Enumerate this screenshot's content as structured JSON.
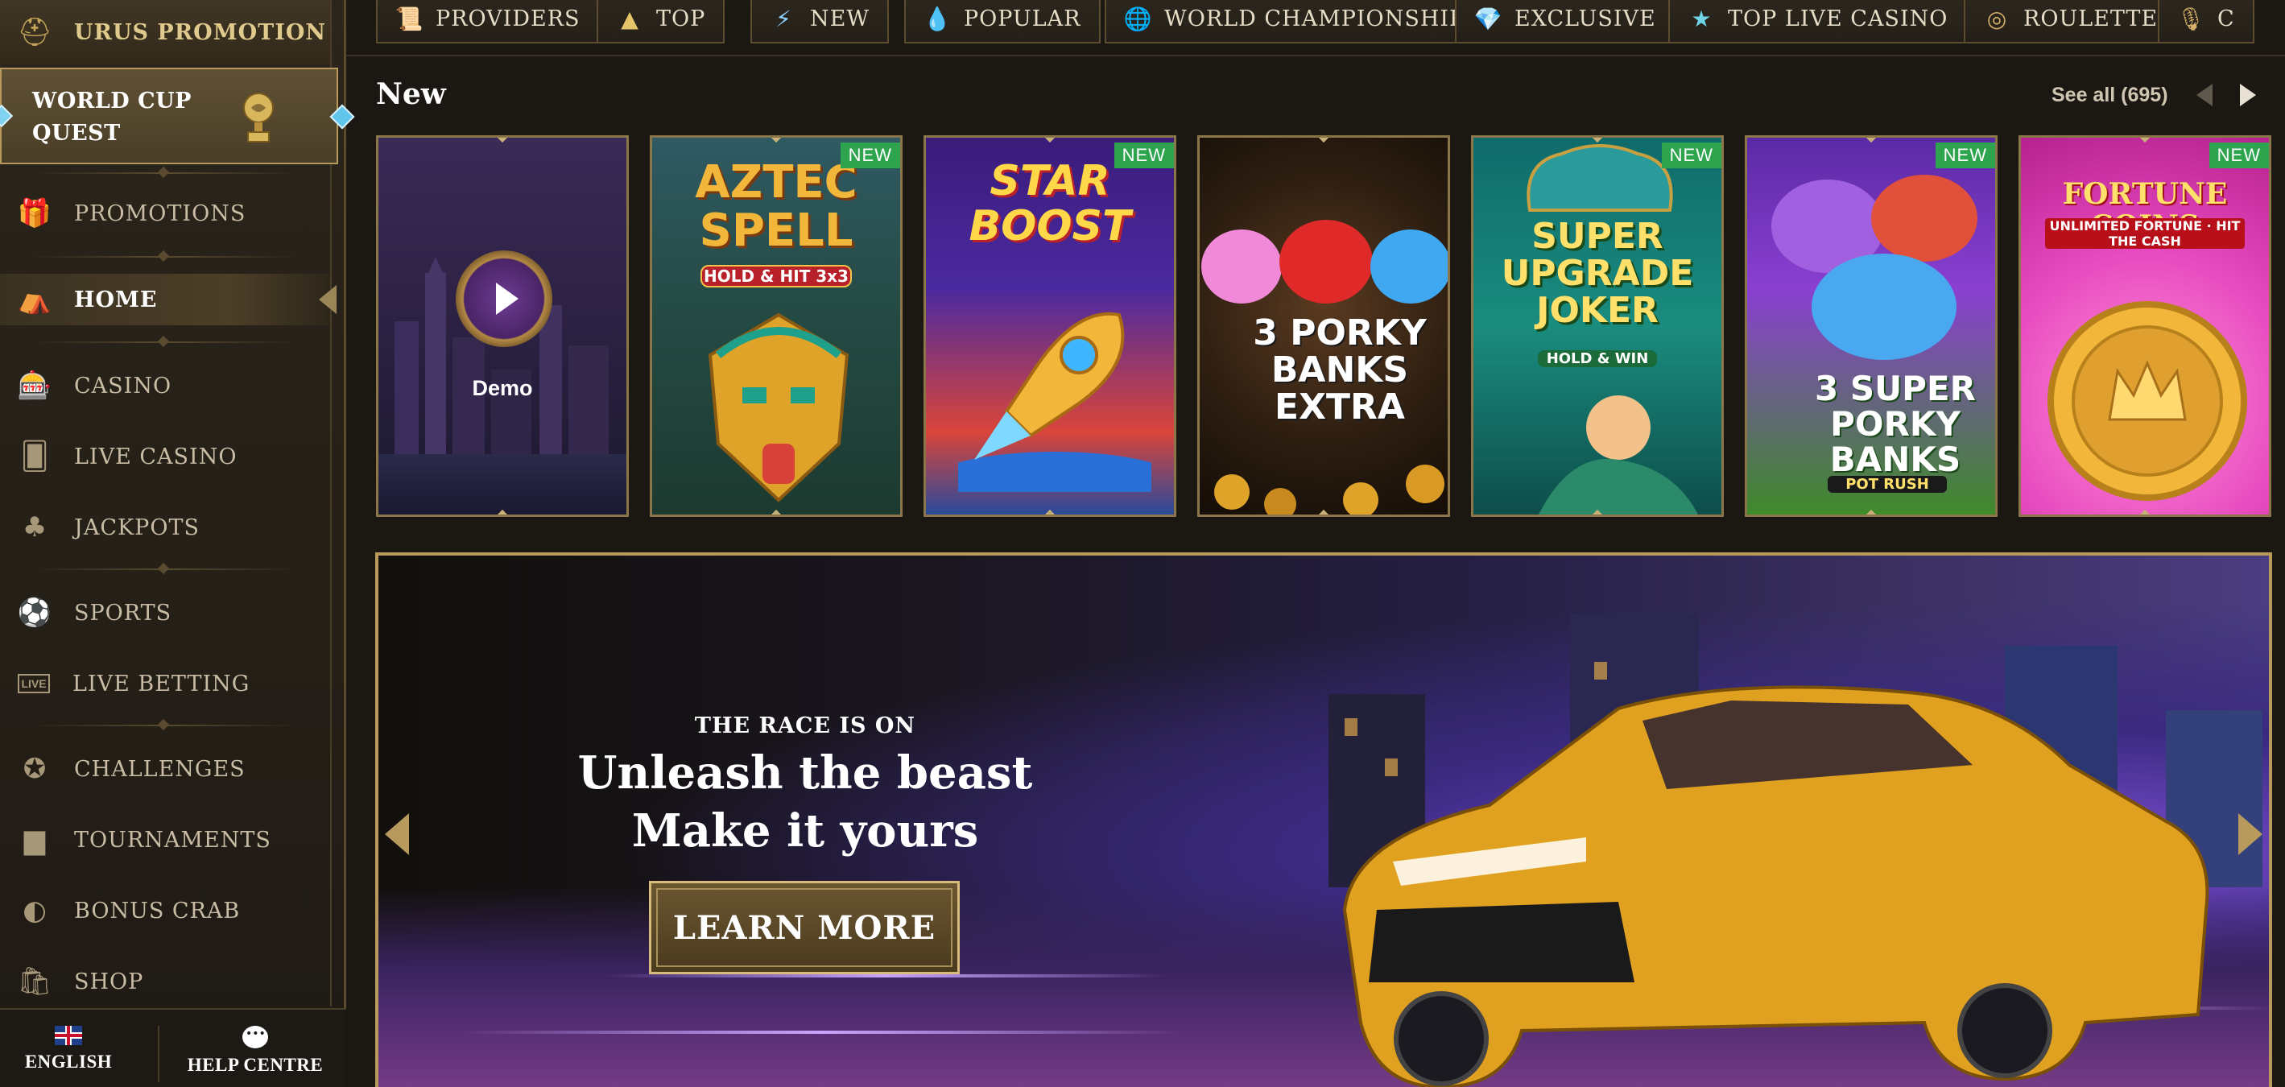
{
  "sidebar": {
    "promo": {
      "label": "URUS PROMOTION"
    },
    "quest": {
      "label_line1": "WORLD CUP",
      "label_line2": "QUEST"
    },
    "items": [
      {
        "label": "PROMOTIONS",
        "icon": "gift-icon"
      },
      {
        "label": "HOME",
        "icon": "home-icon",
        "active": true
      },
      {
        "label": "CASINO",
        "icon": "slot-machine-icon"
      },
      {
        "label": "LIVE CASINO",
        "icon": "playing-card-icon"
      },
      {
        "label": "JACKPOTS",
        "icon": "clover-icon"
      },
      {
        "label": "SPORTS",
        "icon": "ball-icon"
      },
      {
        "label": "LIVE BETTING",
        "icon": "live-icon",
        "icon_text": "LIVE"
      },
      {
        "label": "CHALLENGES",
        "icon": "badge-icon"
      },
      {
        "label": "TOURNAMENTS",
        "icon": "podium-icon"
      },
      {
        "label": "BONUS CRAB",
        "icon": "claw-icon"
      },
      {
        "label": "SHOP",
        "icon": "shopping-bag-icon"
      }
    ],
    "footer": {
      "language": "ENGLISH",
      "help": "HELP CENTRE"
    }
  },
  "categories": [
    {
      "label": "PROVIDERS",
      "icon": "scroll-icon",
      "glyph": "📜"
    },
    {
      "label": "TOP",
      "icon": "pyramid-icon",
      "glyph": "▲"
    },
    {
      "label": "NEW",
      "icon": "lightning-icon",
      "glyph": "⚡"
    },
    {
      "label": "POPULAR",
      "icon": "flame-icon",
      "glyph": "💧"
    },
    {
      "label": "WORLD CHAMPIONSHIP",
      "icon": "globe-icon",
      "glyph": "🌐"
    },
    {
      "label": "EXCLUSIVE",
      "icon": "gem-icon",
      "glyph": "💎"
    },
    {
      "label": "TOP LIVE CASINO",
      "icon": "star-icon",
      "glyph": "★"
    },
    {
      "label": "ROULETTE",
      "icon": "roulette-icon",
      "glyph": "◎"
    },
    {
      "label": "C",
      "icon": "microphone-icon",
      "glyph": "🎙"
    }
  ],
  "section": {
    "title": "New",
    "see_all": "See all (695)"
  },
  "games": [
    {
      "title": "",
      "demo_label": "Demo",
      "badge": ""
    },
    {
      "title": "AZTEC SPELL",
      "subtitle": "HOLD & HIT 3x3",
      "badge": "NEW"
    },
    {
      "title": "STAR BOOST",
      "subtitle": "",
      "badge": "NEW"
    },
    {
      "title": "3 PORKY BANKS EXTRA",
      "subtitle": "",
      "badge": ""
    },
    {
      "title": "SUPER UPGRADE JOKER",
      "subtitle": "HOLD & WIN",
      "badge": "NEW"
    },
    {
      "title": "3 SUPER PORKY BANKS",
      "subtitle": "POT RUSH",
      "badge": "NEW"
    },
    {
      "title": "FORTUNE COINS",
      "subtitle": "UNLIMITED FORTUNE · HIT THE CASH",
      "badge": "NEW"
    }
  ],
  "banner": {
    "eyebrow": "THE RACE IS ON",
    "headline_1": "Unleash the beast",
    "headline_2": "Make it yours",
    "cta": "LEARN MORE"
  },
  "colors": {
    "accent_gold": "#b89b5c",
    "badge_green": "#2ea44f",
    "background": "#1b1712"
  }
}
